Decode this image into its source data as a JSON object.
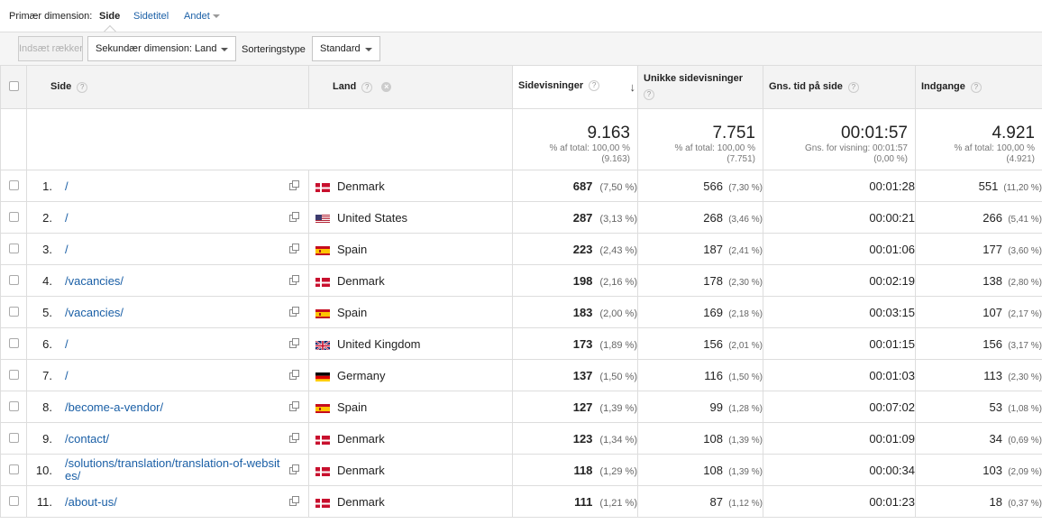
{
  "primary_dimension": {
    "label": "Primær dimension:",
    "options": [
      "Side",
      "Sidetitel",
      "Andet"
    ],
    "active": "Side"
  },
  "toolbar": {
    "insert_rows": "Indsæt rækker",
    "secondary_dimension": "Sekundær dimension: Land",
    "sort_label": "Sorteringstype",
    "sort_value": "Standard"
  },
  "columns": {
    "page": "Side",
    "country": "Land",
    "pageviews": "Sidevisninger",
    "unique": "Unikke sidevisninger",
    "avg_time": "Gns. tid på side",
    "entrances": "Indgange"
  },
  "totals": {
    "pageviews": {
      "value": "9.163",
      "line1": "% af total: 100,00 %",
      "line2": "(9.163)"
    },
    "unique": {
      "value": "7.751",
      "line1": "% af total: 100,00 %",
      "line2": "(7.751)"
    },
    "avg_time": {
      "value": "00:01:57",
      "line1": "Gns. for visning: 00:01:57",
      "line2": "(0,00 %)"
    },
    "entrances": {
      "value": "4.921",
      "line1": "% af total: 100,00 %",
      "line2": "(4.921)"
    }
  },
  "rows": [
    {
      "n": "1.",
      "path": "/",
      "country": "Denmark",
      "flag": "dk",
      "pv": "687",
      "pv_pct": "(7,50 %)",
      "u": "566",
      "u_pct": "(7,30 %)",
      "t": "00:01:28",
      "e": "551",
      "e_pct": "(11,20 %)"
    },
    {
      "n": "2.",
      "path": "/",
      "country": "United States",
      "flag": "us",
      "pv": "287",
      "pv_pct": "(3,13 %)",
      "u": "268",
      "u_pct": "(3,46 %)",
      "t": "00:00:21",
      "e": "266",
      "e_pct": "(5,41 %)"
    },
    {
      "n": "3.",
      "path": "/",
      "country": "Spain",
      "flag": "es",
      "pv": "223",
      "pv_pct": "(2,43 %)",
      "u": "187",
      "u_pct": "(2,41 %)",
      "t": "00:01:06",
      "e": "177",
      "e_pct": "(3,60 %)"
    },
    {
      "n": "4.",
      "path": "/vacancies/",
      "country": "Denmark",
      "flag": "dk",
      "pv": "198",
      "pv_pct": "(2,16 %)",
      "u": "178",
      "u_pct": "(2,30 %)",
      "t": "00:02:19",
      "e": "138",
      "e_pct": "(2,80 %)"
    },
    {
      "n": "5.",
      "path": "/vacancies/",
      "country": "Spain",
      "flag": "es",
      "pv": "183",
      "pv_pct": "(2,00 %)",
      "u": "169",
      "u_pct": "(2,18 %)",
      "t": "00:03:15",
      "e": "107",
      "e_pct": "(2,17 %)"
    },
    {
      "n": "6.",
      "path": "/",
      "country": "United Kingdom",
      "flag": "gb",
      "pv": "173",
      "pv_pct": "(1,89 %)",
      "u": "156",
      "u_pct": "(2,01 %)",
      "t": "00:01:15",
      "e": "156",
      "e_pct": "(3,17 %)"
    },
    {
      "n": "7.",
      "path": "/",
      "country": "Germany",
      "flag": "de",
      "pv": "137",
      "pv_pct": "(1,50 %)",
      "u": "116",
      "u_pct": "(1,50 %)",
      "t": "00:01:03",
      "e": "113",
      "e_pct": "(2,30 %)"
    },
    {
      "n": "8.",
      "path": "/become-a-vendor/",
      "country": "Spain",
      "flag": "es",
      "pv": "127",
      "pv_pct": "(1,39 %)",
      "u": "99",
      "u_pct": "(1,28 %)",
      "t": "00:07:02",
      "e": "53",
      "e_pct": "(1,08 %)"
    },
    {
      "n": "9.",
      "path": "/contact/",
      "country": "Denmark",
      "flag": "dk",
      "pv": "123",
      "pv_pct": "(1,34 %)",
      "u": "108",
      "u_pct": "(1,39 %)",
      "t": "00:01:09",
      "e": "34",
      "e_pct": "(0,69 %)"
    },
    {
      "n": "10.",
      "path": "/solutions/translation/translation-of-websites/",
      "country": "Denmark",
      "flag": "dk",
      "pv": "118",
      "pv_pct": "(1,29 %)",
      "u": "108",
      "u_pct": "(1,39 %)",
      "t": "00:00:34",
      "e": "103",
      "e_pct": "(2,09 %)"
    },
    {
      "n": "11.",
      "path": "/about-us/",
      "country": "Denmark",
      "flag": "dk",
      "pv": "111",
      "pv_pct": "(1,21 %)",
      "u": "87",
      "u_pct": "(1,12 %)",
      "t": "00:01:23",
      "e": "18",
      "e_pct": "(0,37 %)"
    }
  ],
  "icons": {
    "help": "question-circle-icon",
    "remove": "close-circle-icon",
    "sort": "arrow-down-icon",
    "open_page": "external-link-icon"
  },
  "colors": {
    "link": "#1a5fa6",
    "header_bg": "#f3f3f3",
    "border": "#dddddd"
  }
}
